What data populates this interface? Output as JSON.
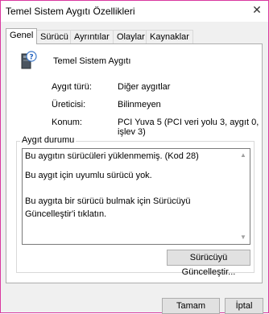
{
  "window": {
    "title": "Temel Sistem Aygıtı Özellikleri",
    "close_glyph": "✕"
  },
  "tabs": [
    {
      "label": "Genel",
      "active": true
    },
    {
      "label": "Sürücü",
      "active": false
    },
    {
      "label": "Ayrıntılar",
      "active": false
    },
    {
      "label": "Olaylar",
      "active": false
    },
    {
      "label": "Kaynaklar",
      "active": false
    }
  ],
  "device": {
    "name": "Temel Sistem Aygıtı",
    "icon": "unknown-device-icon"
  },
  "properties": [
    {
      "label": "Aygıt türü:",
      "value": "Diğer aygıtlar"
    },
    {
      "label": "Üreticisi:",
      "value": "Bilinmeyen"
    },
    {
      "label": "Konum:",
      "value": "PCI Yuva 5 (PCI veri yolu 3, aygıt 0, işlev 3)"
    }
  ],
  "status": {
    "group_title": "Aygıt durumu",
    "lines": [
      "Bu aygıtın sürücüleri yüklenmemiş. (Kod 28)",
      "Bu aygıt için uyumlu sürücü yok.",
      "Bu aygıta bir sürücü bulmak için Sürücüyü Güncelleştir'i tıklatın."
    ],
    "update_button": "Sürücüyü Güncelleştir..."
  },
  "footer": {
    "ok_button": "Tamam",
    "cancel_button": "İptal"
  }
}
